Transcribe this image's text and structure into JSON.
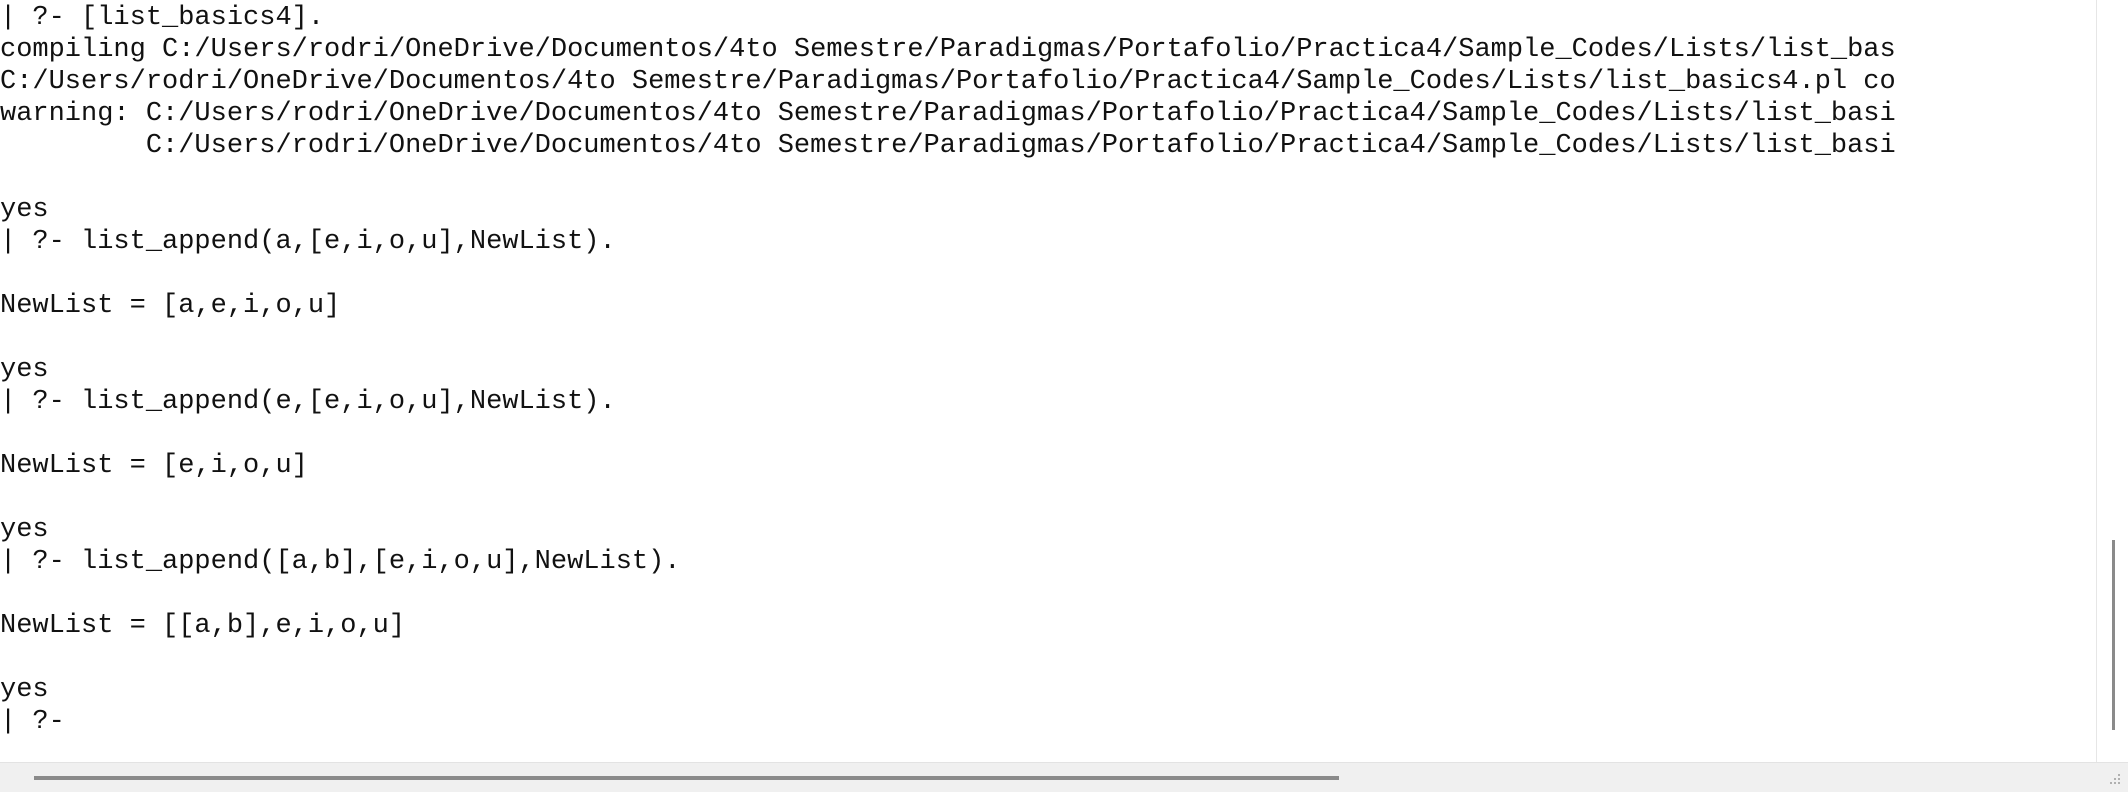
{
  "console": {
    "lines": [
      "| ?- [list_basics4].",
      "compiling C:/Users/rodri/OneDrive/Documentos/4to Semestre/Paradigmas/Portafolio/Practica4/Sample_Codes/Lists/list_bas",
      "C:/Users/rodri/OneDrive/Documentos/4to Semestre/Paradigmas/Portafolio/Practica4/Sample_Codes/Lists/list_basics4.pl co",
      "warning: C:/Users/rodri/OneDrive/Documentos/4to Semestre/Paradigmas/Portafolio/Practica4/Sample_Codes/Lists/list_basi",
      "         C:/Users/rodri/OneDrive/Documentos/4to Semestre/Paradigmas/Portafolio/Practica4/Sample_Codes/Lists/list_basi",
      "",
      "yes",
      "| ?- list_append(a,[e,i,o,u],NewList).",
      "",
      "NewList = [a,e,i,o,u]",
      "",
      "yes",
      "| ?- list_append(e,[e,i,o,u],NewList).",
      "",
      "NewList = [e,i,o,u]",
      "",
      "yes",
      "| ?- list_append([a,b],[e,i,o,u],NewList).",
      "",
      "NewList = [[a,b],e,i,o,u]",
      "",
      "yes",
      "| ?- "
    ]
  }
}
